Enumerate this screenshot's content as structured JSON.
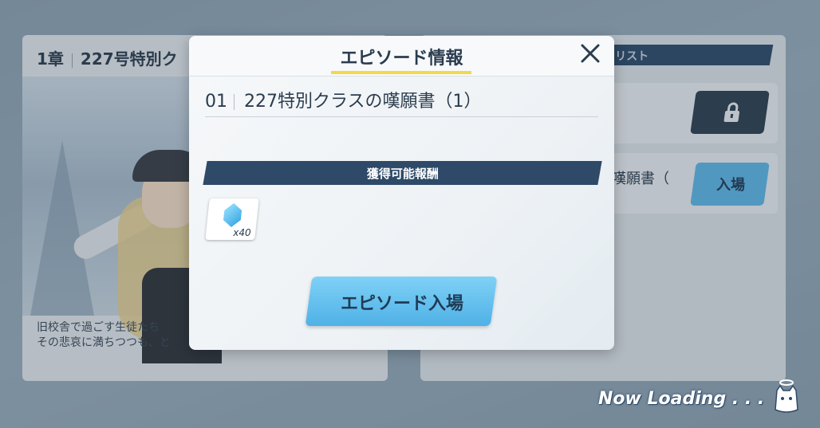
{
  "background": {
    "chapter_label": "1章",
    "chapter_title": "227号特別ク",
    "description_lines": [
      "旧校舎で過ごす生徒たち",
      "その悲哀に満ちつつも、と"
    ],
    "list_header": "リスト",
    "episode_row_2_text": "嘆願書（",
    "enter_label": "入場",
    "lock_icon": "lock-icon"
  },
  "dialog": {
    "title": "エピソード情報",
    "close_icon": "close-icon",
    "episode_number": "01",
    "episode_title": "227特別クラスの嘆願書（1）",
    "reward_header": "獲得可能報酬",
    "reward_items": [
      {
        "icon": "gem-icon",
        "quantity": "x40"
      }
    ],
    "enter_button": "エピソード入場"
  },
  "loading": {
    "text": "Now Loading . . ."
  }
}
